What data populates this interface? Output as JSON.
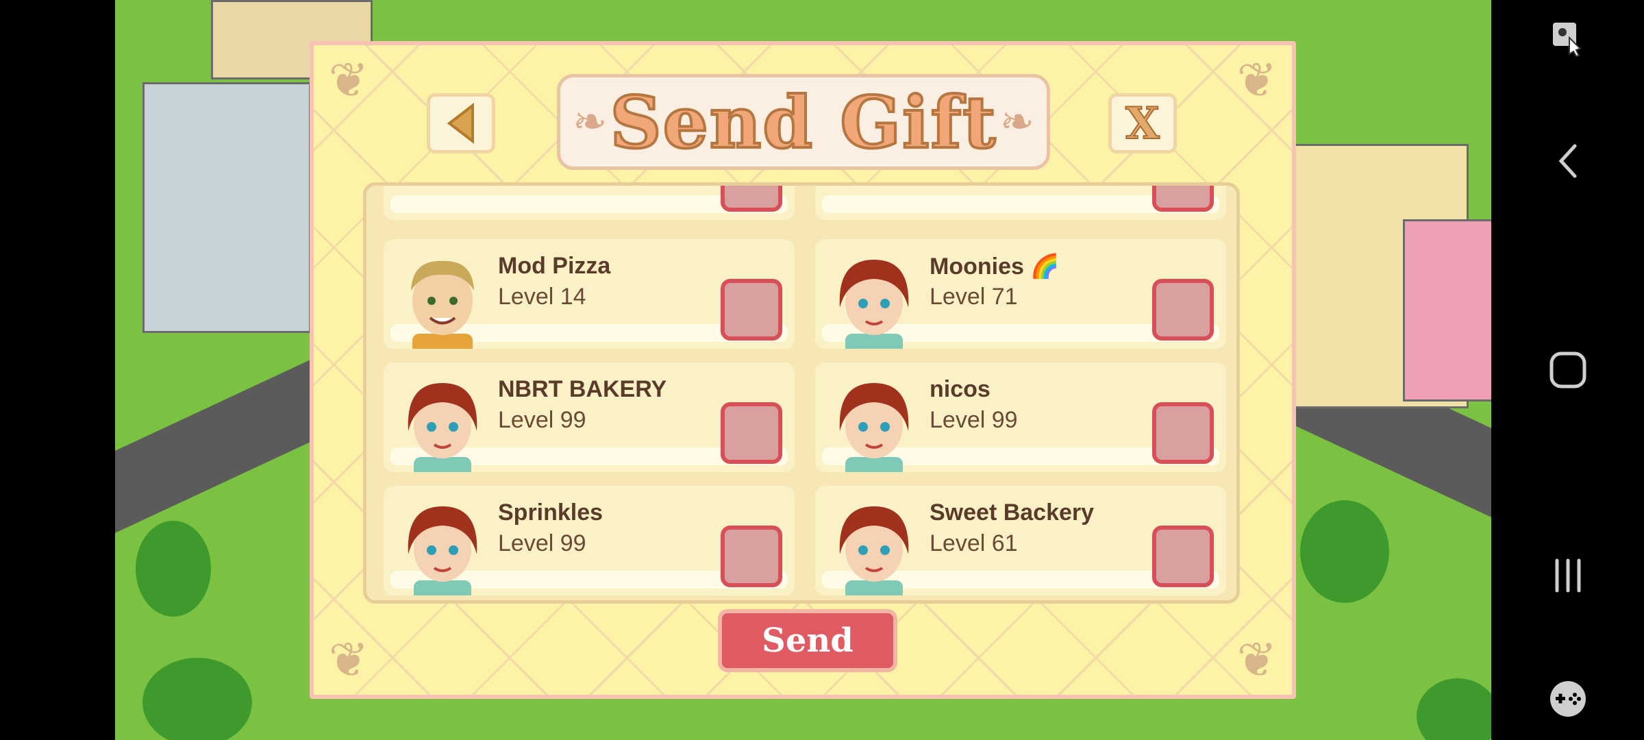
{
  "dialog": {
    "title": "Send Gift",
    "close_label": "X",
    "send_label": "Send"
  },
  "friends": [
    {
      "name": "Mod Pizza",
      "level": "Level 14",
      "avatar": "boy-avatar"
    },
    {
      "name": "Moonies 🌈",
      "level": "Level 71",
      "avatar": "girl-avatar"
    },
    {
      "name": "NBRT BAKERY",
      "level": "Level 99",
      "avatar": "girl-avatar"
    },
    {
      "name": "nicos",
      "level": "Level 99",
      "avatar": "girl-avatar"
    },
    {
      "name": "Sprinkles",
      "level": "Level 99",
      "avatar": "girl-avatar"
    },
    {
      "name": "Sweet Backery",
      "level": "Level 61",
      "avatar": "girl-avatar"
    }
  ],
  "colors": {
    "dialog_bg": "#fdf3a6",
    "checkbox_border": "#d94f57",
    "send_button": "#e05a62",
    "text": "#5a3b2a"
  }
}
